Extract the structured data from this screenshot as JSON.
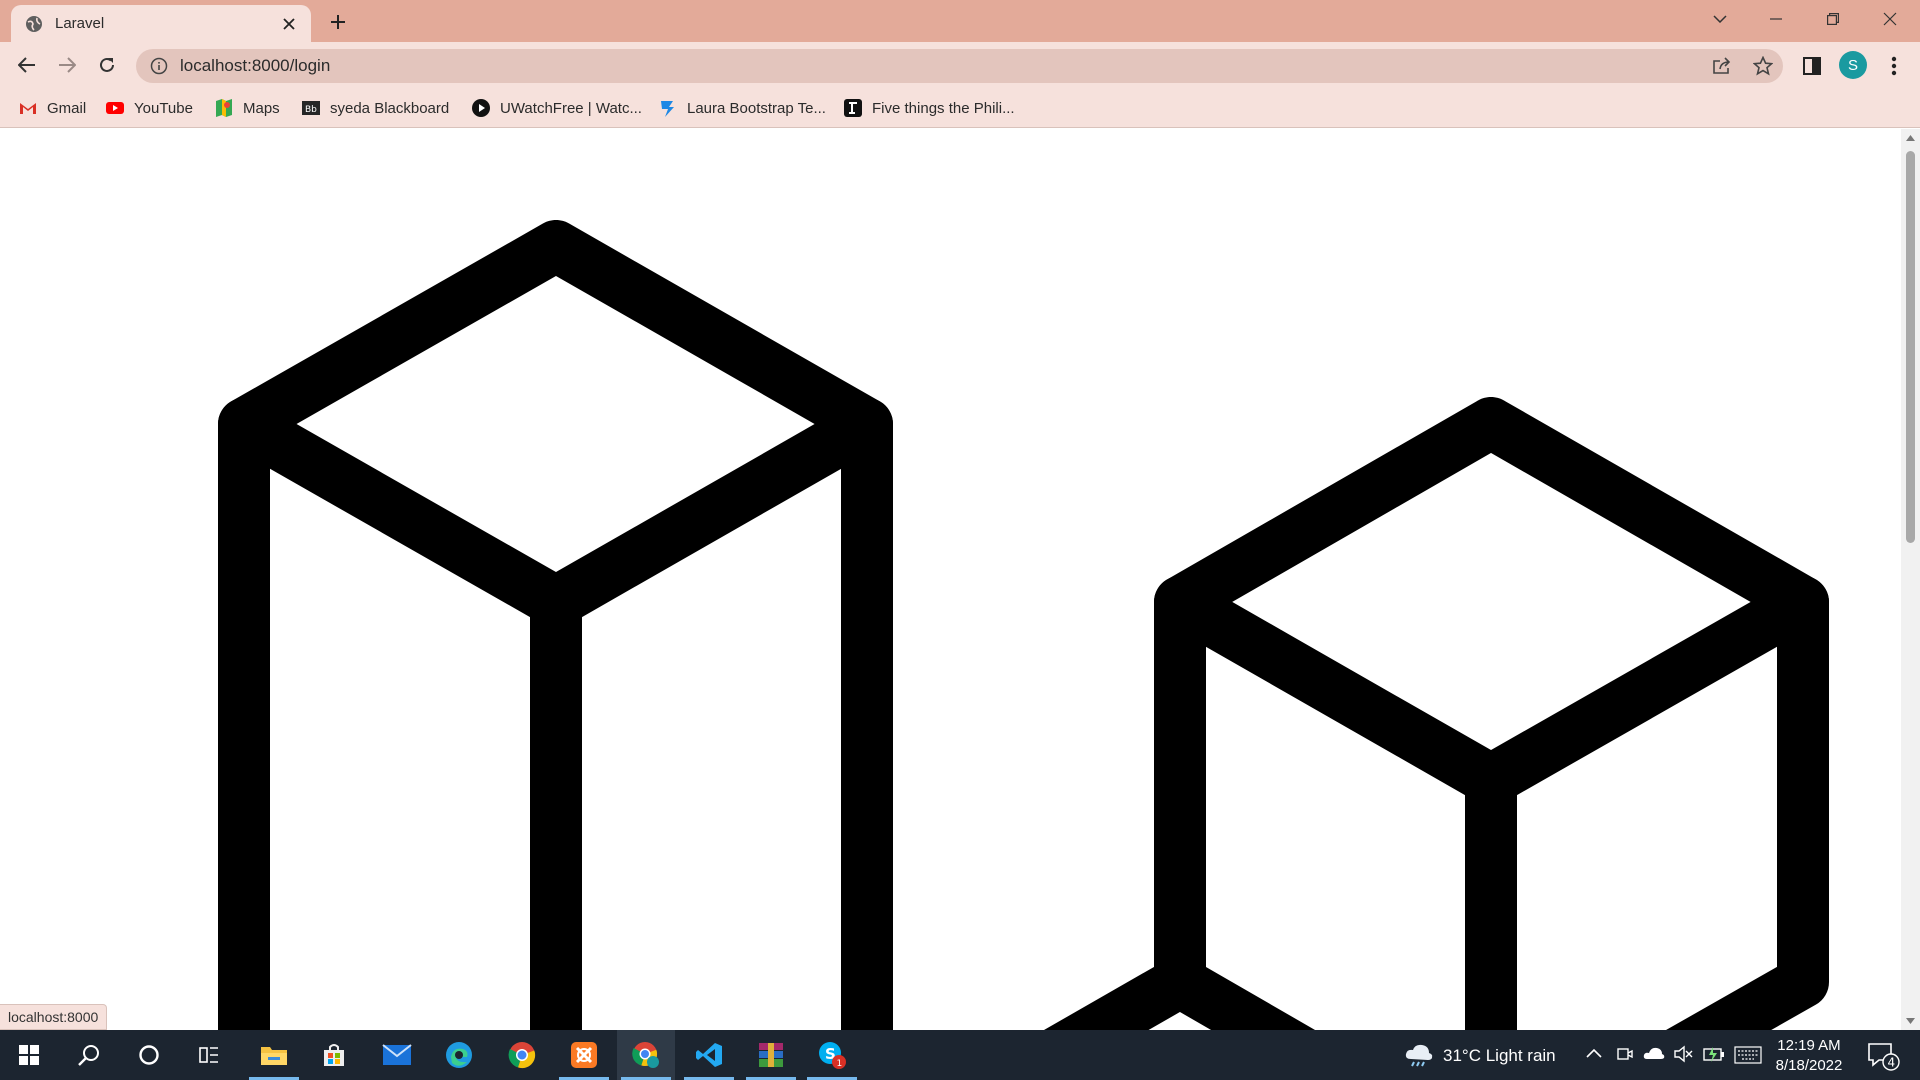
{
  "browser": {
    "tab_title": "Laravel",
    "url": "localhost:8000/login",
    "status_url": "localhost:8000",
    "profile_initial": "S"
  },
  "bookmarks": [
    {
      "label": "Gmail",
      "icon": "gmail-icon"
    },
    {
      "label": "YouTube",
      "icon": "youtube-icon"
    },
    {
      "label": "Maps",
      "icon": "maps-icon"
    },
    {
      "label": "syeda Blackboard",
      "icon": "blackboard-icon"
    },
    {
      "label": "UWatchFree | Watc...",
      "icon": "play-icon"
    },
    {
      "label": "Laura Bootstrap Te...",
      "icon": "bootstrap-icon"
    },
    {
      "label": "Five things the Phili...",
      "icon": "article-icon"
    }
  ],
  "page": {
    "graphic": "laravel-cubes-illustration"
  },
  "taskbar": {
    "weather": "31°C  Light rain",
    "time": "12:19 AM",
    "date": "8/18/2022",
    "notifications": "4",
    "skype_badge": "1",
    "apps": [
      "start-icon",
      "search-icon",
      "cortana-icon",
      "task-view-icon",
      "file-explorer-icon",
      "store-icon",
      "mail-icon",
      "edge-icon",
      "chrome-icon",
      "xampp-icon",
      "chrome-profile-icon",
      "vscode-icon",
      "winrar-icon",
      "skype-icon"
    ]
  },
  "colors": {
    "tabstrip": "#e3aa99",
    "toolbar": "#f6e1dc",
    "omnibox": "#e3c5bd",
    "taskbar": "#1c2530"
  }
}
